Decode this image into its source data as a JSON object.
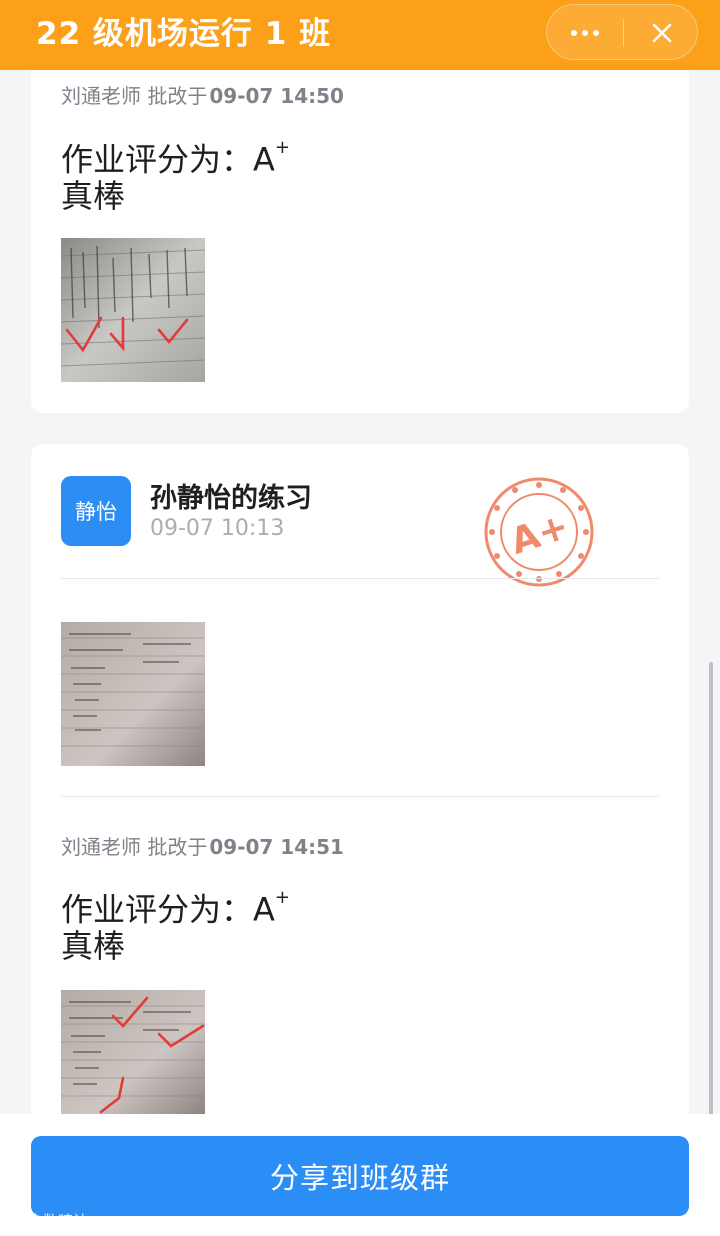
{
  "header": {
    "title": "22 级机场运行 1 班"
  },
  "first_review": {
    "teacher": "刘通老师",
    "action": "批改于",
    "time": "09-07 14:50",
    "grade_label": "作业评分为：A",
    "grade_sup": "+",
    "comment": "真棒"
  },
  "submission": {
    "avatar_text": "静怡",
    "title": "孙静怡的练习",
    "time": "09-07 10:13",
    "stamp_text": "A+"
  },
  "second_review": {
    "teacher": "刘通老师",
    "action": "批改于",
    "time": "09-07 14:51",
    "grade_label": "作业评分为：A",
    "grade_sup": "+",
    "comment": "真棒"
  },
  "share_button": "分享到班级群",
  "watermark": "大数暗访",
  "icons": [
    "more-icon",
    "close-icon",
    "grade-stamp-icon"
  ],
  "colors": {
    "header": "#fca019",
    "button": "#2b8df6",
    "avatar": "#2c8df4",
    "stamp": "#ef8a6a"
  }
}
